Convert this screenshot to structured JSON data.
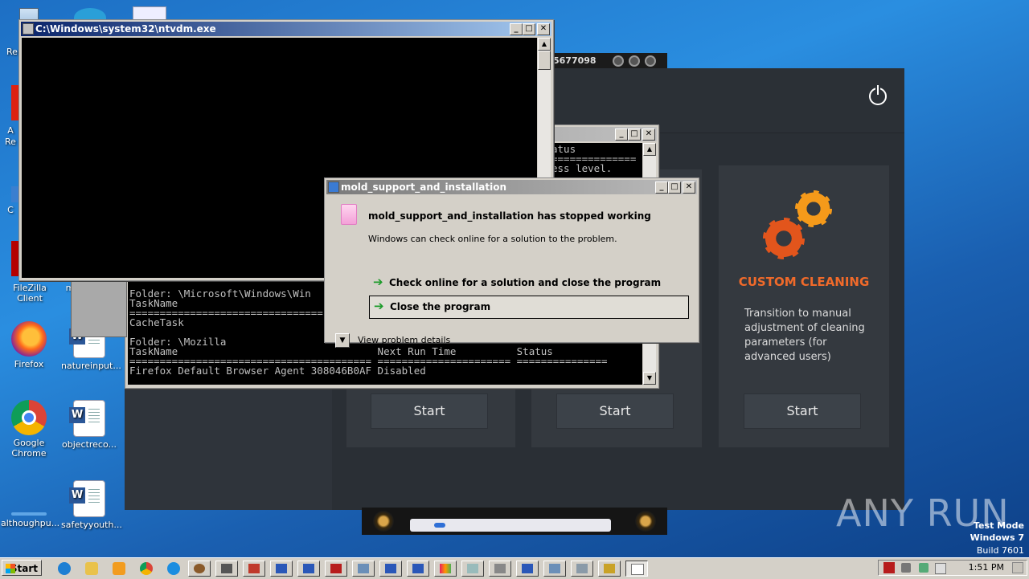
{
  "desktop": {
    "icons": [
      {
        "label": "Re"
      },
      {
        "label": "A\nRe"
      },
      {
        "label": "C"
      },
      {
        "label": "FileZilla Client"
      },
      {
        "label": "m"
      },
      {
        "label": "Firefox"
      },
      {
        "label": "natureinput..."
      },
      {
        "label": "Google Chrome"
      },
      {
        "label": "objectreco..."
      },
      {
        "label": "althoughpu..."
      },
      {
        "label": "safetyyouth..."
      }
    ],
    "watermark": "ANY RUN",
    "test_mode": {
      "line1": "Test Mode",
      "line2": "Windows 7",
      "line3": "Build 7601"
    }
  },
  "cleaner_app": {
    "cards": [
      {
        "title": "",
        "description": "",
        "button": "Start"
      },
      {
        "title": "",
        "description": "",
        "button": "Start"
      },
      {
        "title": "CUSTOM CLEANING",
        "description": "Transition to manual adjustment of cleaning parameters (for advanced users)",
        "button": "Start"
      }
    ],
    "colors": {
      "accent": "#f06a2a",
      "background": "#2a2f35"
    }
  },
  "media_player": {
    "counter": "5677098"
  },
  "ntvdm_window": {
    "title": "C:\\Windows\\system32\\ntvdm.exe"
  },
  "schtasks_window": {
    "lines_top": [
      "atus",
      "==============",
      "ess level."
    ],
    "lines_bottom": [
      "Folder: \\Microsoft\\Windows\\Win",
      "TaskName",
      "================================",
      "CacheTask",
      "",
      "Folder: \\Mozilla",
      "TaskName                                 Next Run Time          Status",
      "======================================== ====================== ===============",
      "Firefox Default Browser Agent 308046B0AF Disabled"
    ]
  },
  "error_dialog": {
    "title": "mold_support_and_installation",
    "heading": "mold_support_and_installation has stopped working",
    "message": "Windows can check online for a solution to the problem.",
    "option_check": "Check online for a solution and close the program",
    "option_close": "Close the program",
    "details": "View problem details"
  },
  "taskbar": {
    "start_label": "Start",
    "clock": "1:51 PM",
    "colors": {
      "face": "#d4d0c8"
    }
  }
}
